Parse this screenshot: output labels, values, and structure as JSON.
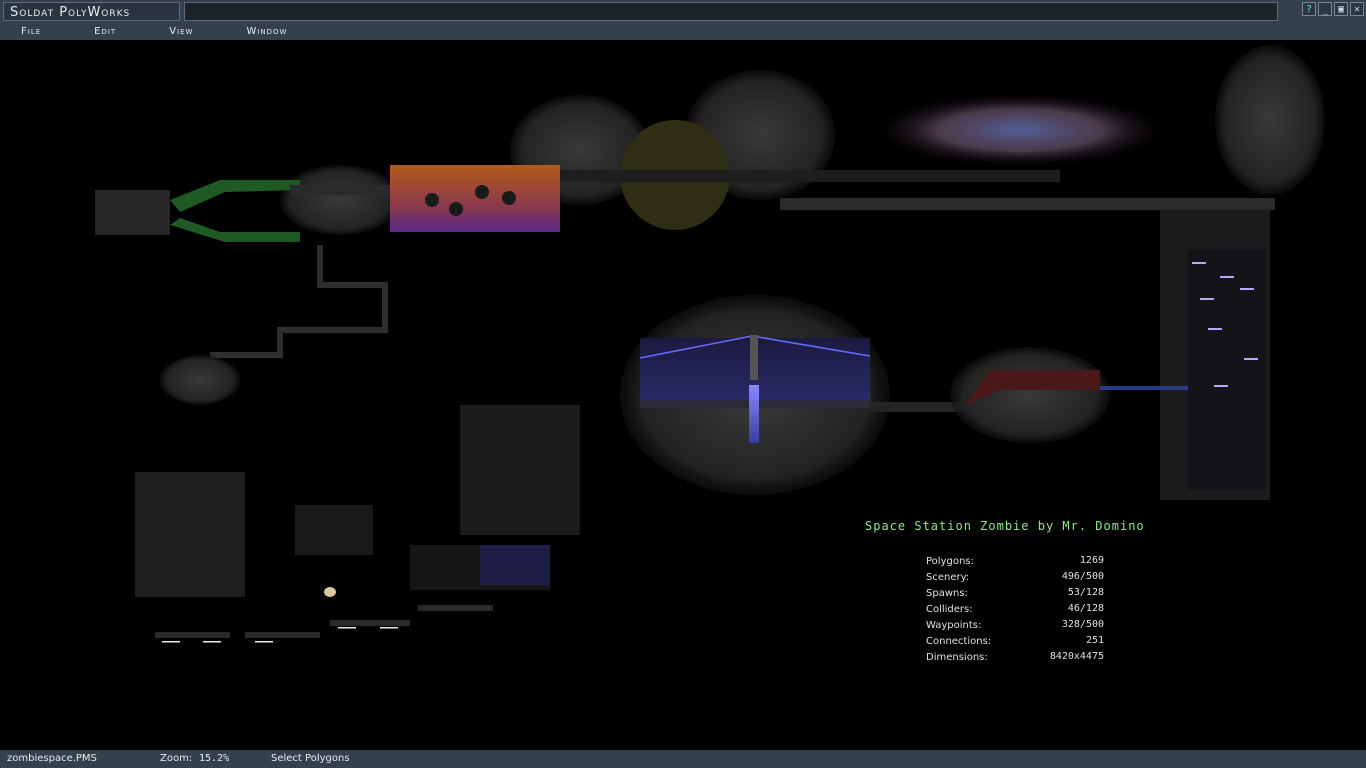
{
  "app": {
    "title": "Soldat PolyWorks"
  },
  "window_controls": {
    "help": "?",
    "minimize": "_",
    "maximize": "▣",
    "close": "✕"
  },
  "menu": [
    {
      "label": "File"
    },
    {
      "label": "Edit"
    },
    {
      "label": "View"
    },
    {
      "label": "Window"
    }
  ],
  "map": {
    "title": "Space Station Zombie by Mr. Domino",
    "stats": [
      {
        "label": "Polygons:",
        "value": "1269"
      },
      {
        "label": "Scenery:",
        "value": "496/500"
      },
      {
        "label": "Spawns:",
        "value": "53/128"
      },
      {
        "label": "Colliders:",
        "value": "46/128"
      },
      {
        "label": "Waypoints:",
        "value": "328/500"
      },
      {
        "label": "Connections:",
        "value": "251"
      },
      {
        "label": "Dimensions:",
        "value": "8420x4475"
      }
    ]
  },
  "status": {
    "file": "zombiespace.PMS",
    "zoom_label": "Zoom:",
    "zoom_value": "15.2%",
    "tool": "Select Polygons"
  },
  "colors": {
    "chrome": "#34404c",
    "viewport_bg": "#000000",
    "map_title": "#8ee88a",
    "stats_text": "#dfe3e6"
  }
}
